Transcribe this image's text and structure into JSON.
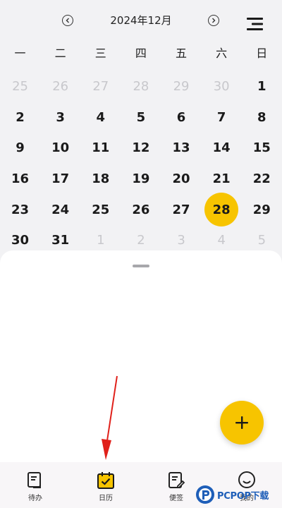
{
  "header": {
    "month_title": "2024年12月"
  },
  "weekdays": [
    "一",
    "二",
    "三",
    "四",
    "五",
    "六",
    "日"
  ],
  "calendar": {
    "selected_day": "28",
    "weeks": [
      [
        {
          "d": "25",
          "m": true
        },
        {
          "d": "26",
          "m": true
        },
        {
          "d": "27",
          "m": true
        },
        {
          "d": "28",
          "m": true
        },
        {
          "d": "29",
          "m": true
        },
        {
          "d": "30",
          "m": true
        },
        {
          "d": "1",
          "m": false
        }
      ],
      [
        {
          "d": "2",
          "m": false
        },
        {
          "d": "3",
          "m": false
        },
        {
          "d": "4",
          "m": false
        },
        {
          "d": "5",
          "m": false
        },
        {
          "d": "6",
          "m": false
        },
        {
          "d": "7",
          "m": false
        },
        {
          "d": "8",
          "m": false
        }
      ],
      [
        {
          "d": "9",
          "m": false
        },
        {
          "d": "10",
          "m": false
        },
        {
          "d": "11",
          "m": false
        },
        {
          "d": "12",
          "m": false
        },
        {
          "d": "13",
          "m": false
        },
        {
          "d": "14",
          "m": false
        },
        {
          "d": "15",
          "m": false
        }
      ],
      [
        {
          "d": "16",
          "m": false
        },
        {
          "d": "17",
          "m": false
        },
        {
          "d": "18",
          "m": false
        },
        {
          "d": "19",
          "m": false
        },
        {
          "d": "20",
          "m": false
        },
        {
          "d": "21",
          "m": false
        },
        {
          "d": "22",
          "m": false
        }
      ],
      [
        {
          "d": "23",
          "m": false
        },
        {
          "d": "24",
          "m": false
        },
        {
          "d": "25",
          "m": false
        },
        {
          "d": "26",
          "m": false
        },
        {
          "d": "27",
          "m": false
        },
        {
          "d": "28",
          "m": false,
          "sel": true
        },
        {
          "d": "29",
          "m": false
        }
      ],
      [
        {
          "d": "30",
          "m": false
        },
        {
          "d": "31",
          "m": false
        },
        {
          "d": "1",
          "m": true
        },
        {
          "d": "2",
          "m": true
        },
        {
          "d": "3",
          "m": true
        },
        {
          "d": "4",
          "m": true
        },
        {
          "d": "5",
          "m": true
        }
      ]
    ]
  },
  "tabbar": {
    "todo_label": "待办",
    "calendar_label": "日历",
    "notes_label": "便签",
    "mine_label": "我的"
  },
  "watermark": {
    "text": "PCPOP下载"
  },
  "colors": {
    "accent": "#f7c400",
    "muted_day": "#c8c8cc",
    "annotation_arrow": "#e0201a"
  }
}
